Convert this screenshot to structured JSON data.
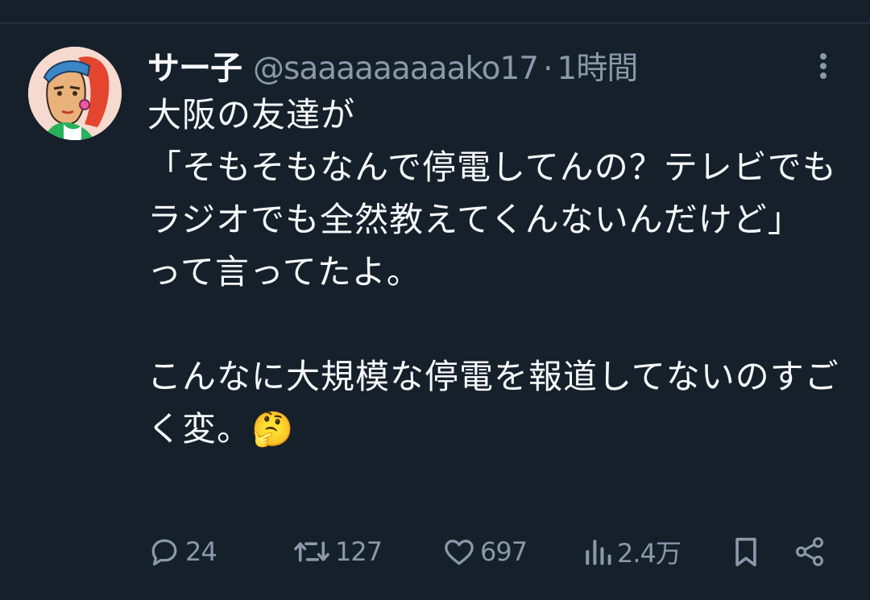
{
  "tweet": {
    "display_name": "サー子",
    "handle": "@saaaaaaaaako17",
    "separator": "·",
    "time": "1時間",
    "text": "大阪の友達が\n「そもそもなんで停電してんの？テレビでもラジオでも全然教えてくんないんだけど」\nって言ってたよ。\n\nこんなに大規模な停電を報道してないのすごく変。🤔"
  },
  "actions": {
    "replies": "24",
    "retweets": "127",
    "likes": "697",
    "views": "2.4万"
  },
  "icons": {
    "more": "more-vertical-icon",
    "reply": "speech-bubble-icon",
    "retweet": "retweet-icon",
    "like": "heart-icon",
    "views": "bar-chart-icon",
    "bookmark": "bookmark-icon",
    "share": "share-icon"
  },
  "colors": {
    "background": "#15202b",
    "text": "#f7f9f9",
    "secondary": "#8b98a5"
  }
}
